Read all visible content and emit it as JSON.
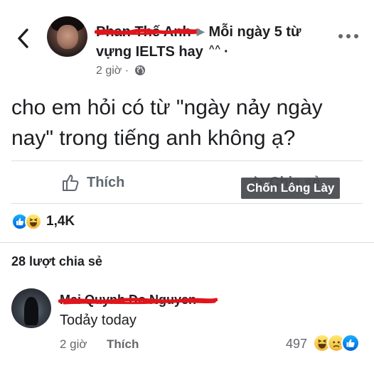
{
  "header": {
    "author": "Phan Thế Anh",
    "group_line1": "Mỗi ngày 5 từ",
    "group_line2": "vựng IELTS hay",
    "group_suffix": "^^",
    "time": "2 giờ"
  },
  "post": {
    "text": "cho em hỏi có từ \"ngày nảy ngày nay\" trong tiếng anh không ạ?"
  },
  "actions": {
    "like_label": "Thích",
    "share_label": "Chia sẻ"
  },
  "watermark": "Chốn Lông Lày",
  "stats": {
    "reaction_count": "1,4K",
    "share_count": "28 lượt chia sẻ"
  },
  "comment": {
    "author": "Mai Quynh Do Nguyen",
    "text": "Todảy today",
    "time": "2 giờ",
    "like_label": "Thích",
    "reaction_count": "497"
  },
  "icons": [
    "back-icon",
    "more-icon",
    "globe-icon",
    "like-outline-icon",
    "share-icon",
    "like-reaction-icon",
    "haha-reaction-icon",
    "sad-reaction-icon"
  ],
  "colors": {
    "accent_blue": "#1877f2",
    "scribble_red": "#e1141c",
    "watermark_bg": "#46484c"
  }
}
